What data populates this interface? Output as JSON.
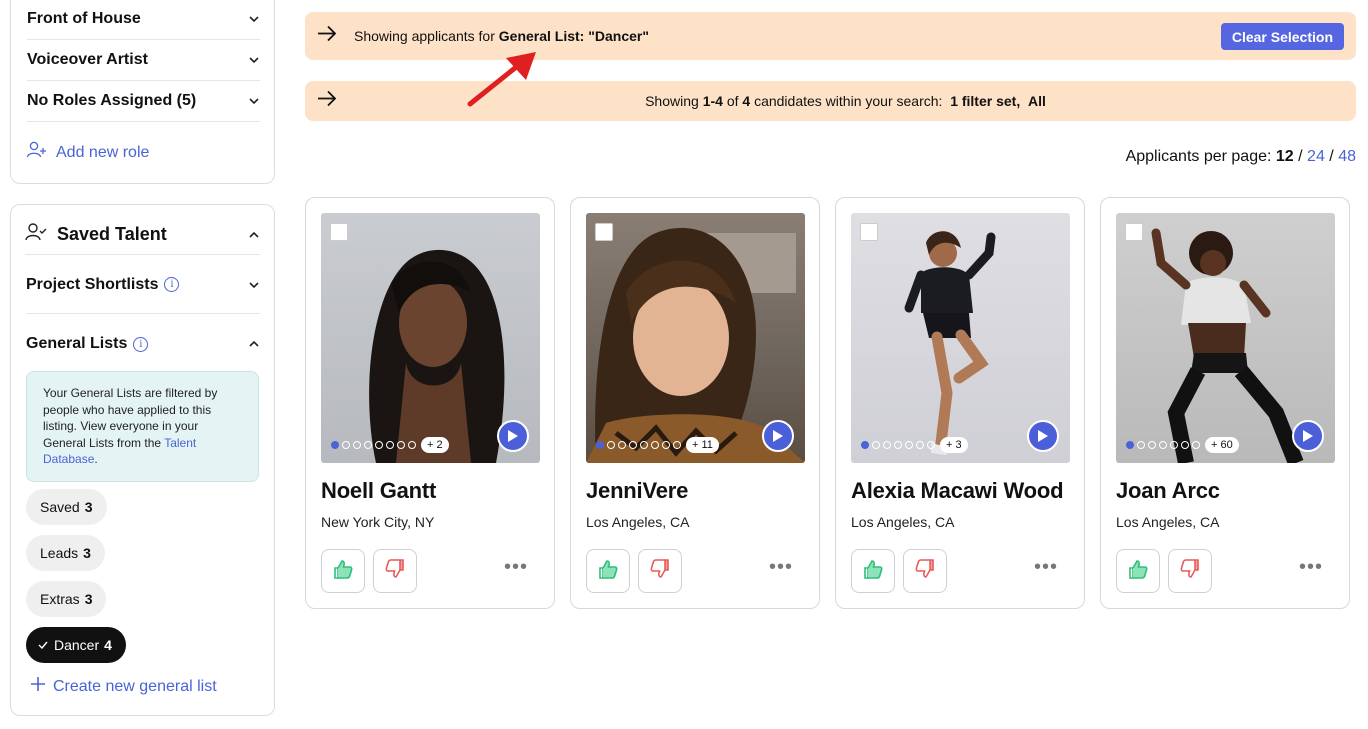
{
  "sidebar": {
    "roles": [
      {
        "label": "Front of House"
      },
      {
        "label": "Voiceover Artist"
      },
      {
        "label": "No Roles Assigned (5)"
      }
    ],
    "add_role_label": "Add new role",
    "saved_talent": {
      "title": "Saved Talent",
      "project_shortlists": "Project Shortlists",
      "general_lists": "General Lists",
      "info_text": "Your General Lists are filtered by people who have applied to this listing. View everyone in your General Lists from the",
      "info_link": "Talent Database",
      "info_end": ".",
      "lists": [
        {
          "label": "Saved",
          "count": "3"
        },
        {
          "label": "Leads",
          "count": "3"
        },
        {
          "label": "Extras",
          "count": "3"
        },
        {
          "label": "Dancer",
          "count": "4"
        }
      ],
      "create_label": "Create new general list"
    }
  },
  "banner1": {
    "prefix": "Showing applicants for",
    "bold": "General List: \"Dancer\"",
    "button": "Clear Selection"
  },
  "banner2": {
    "t1": "Showing",
    "b1": "1-4",
    "t2": "of",
    "b2": "4",
    "t3": "candidates within your search:",
    "b3": "1 filter set,",
    "b4": "All"
  },
  "per_page": {
    "label": "Applicants per page:",
    "current": "12",
    "sep": "/",
    "opt2": "24",
    "opt3": "48"
  },
  "candidates": [
    {
      "name": "Noell Gantt",
      "location": "New York City, NY",
      "more": "+ 2"
    },
    {
      "name": "JenniVere",
      "location": "Los Angeles, CA",
      "more": "+ 11"
    },
    {
      "name": "Alexia Macawi Wood",
      "location": "Los Angeles, CA",
      "more": "+ 3"
    },
    {
      "name": "Joan Arcc",
      "location": "Los Angeles, CA",
      "more": "+ 60"
    }
  ],
  "colors": {
    "accent": "#4a63d6",
    "banner": "#fde2c8",
    "thumb_up": "#2dbf7a",
    "thumb_down": "#e85a5a"
  }
}
